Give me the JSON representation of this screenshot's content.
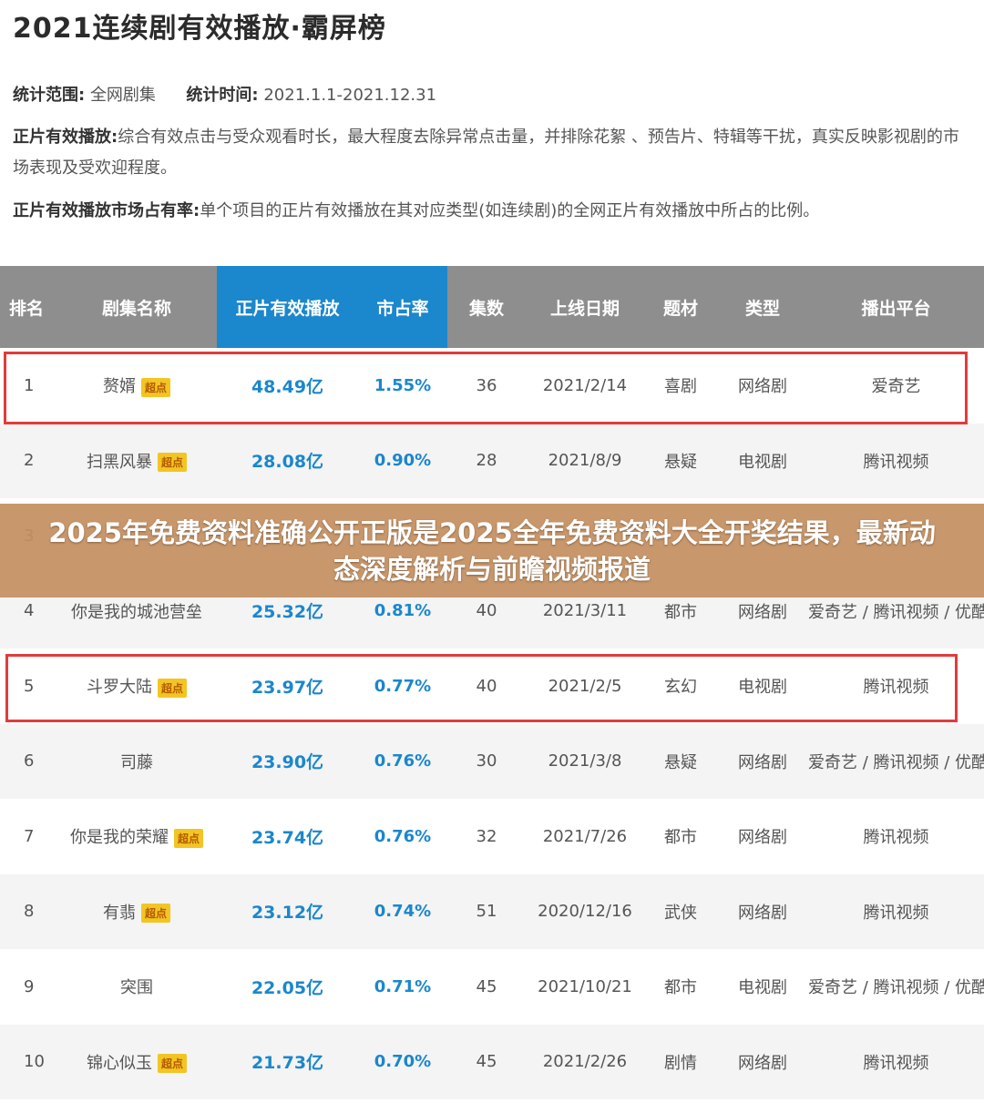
{
  "title": "2021连续剧有效播放·霸屏榜",
  "meta": {
    "scope_label": "统计范围:",
    "scope_value": "全网剧集",
    "time_label": "统计时间:",
    "time_value": "2021.1.1-2021.12.31",
    "play_label": "正片有效播放:",
    "play_desc": "综合有效点击与受众观看时长，最大程度去除异常点击量，并排除花絮 、预告片、特辑等干扰，真实反映影视剧的市场表现及受欢迎程度。",
    "share_label": "正片有效播放市场占有率:",
    "share_desc": "单个项目的正片有效播放在其对应类型(如连续剧)的全网正片有效播放中所占的比例。"
  },
  "table": {
    "headers": [
      "排名",
      "剧集名称",
      "正片有效播放",
      "市占率",
      "集数",
      "上线日期",
      "题材",
      "类型",
      "播出平台"
    ],
    "rows": [
      {
        "rank": "1",
        "name": "赘婿",
        "badge": "超点",
        "play": "48.49亿",
        "share": "1.55%",
        "eps": "36",
        "date": "2021/2/14",
        "genre": "喜剧",
        "type": "网络剧",
        "platform": "爱奇艺"
      },
      {
        "rank": "2",
        "name": "扫黑风暴",
        "badge": "超点",
        "play": "28.08亿",
        "share": "0.90%",
        "eps": "28",
        "date": "2021/8/9",
        "genre": "悬疑",
        "type": "电视剧",
        "platform": "腾讯视频"
      },
      {
        "rank": "3",
        "name": "",
        "badge": "",
        "play": "",
        "share": "",
        "eps": "",
        "date": "",
        "genre": "",
        "type": "",
        "platform": ""
      },
      {
        "rank": "4",
        "name": "你是我的城池营垒",
        "badge": "",
        "play": "25.32亿",
        "share": "0.81%",
        "eps": "40",
        "date": "2021/3/11",
        "genre": "都市",
        "type": "网络剧",
        "platform": "爱奇艺 / 腾讯视频 / 优酷"
      },
      {
        "rank": "5",
        "name": "斗罗大陆",
        "badge": "超点",
        "play": "23.97亿",
        "share": "0.77%",
        "eps": "40",
        "date": "2021/2/5",
        "genre": "玄幻",
        "type": "电视剧",
        "platform": "腾讯视频"
      },
      {
        "rank": "6",
        "name": "司藤",
        "badge": "",
        "play": "23.90亿",
        "share": "0.76%",
        "eps": "30",
        "date": "2021/3/8",
        "genre": "悬疑",
        "type": "网络剧",
        "platform": "爱奇艺 / 腾讯视频 / 优酷"
      },
      {
        "rank": "7",
        "name": "你是我的荣耀",
        "badge": "超点",
        "play": "23.74亿",
        "share": "0.76%",
        "eps": "32",
        "date": "2021/7/26",
        "genre": "都市",
        "type": "网络剧",
        "platform": "腾讯视频"
      },
      {
        "rank": "8",
        "name": "有翡",
        "badge": "超点",
        "play": "23.12亿",
        "share": "0.74%",
        "eps": "51",
        "date": "2020/12/16",
        "genre": "武侠",
        "type": "网络剧",
        "platform": "腾讯视频"
      },
      {
        "rank": "9",
        "name": "突围",
        "badge": "",
        "play": "22.05亿",
        "share": "0.71%",
        "eps": "45",
        "date": "2021/10/21",
        "genre": "都市",
        "type": "电视剧",
        "platform": "爱奇艺 / 腾讯视频 / 优酷"
      },
      {
        "rank": "10",
        "name": "锦心似玉",
        "badge": "超点",
        "play": "21.73亿",
        "share": "0.70%",
        "eps": "45",
        "date": "2021/2/26",
        "genre": "剧情",
        "type": "网络剧",
        "platform": "腾讯视频"
      }
    ]
  },
  "banner": {
    "text": "2025年免费资料准确公开正版是2025全年免费资料大全开奖结果，最新动态深度解析与前瞻视频报道"
  },
  "colors": {
    "accent": "#1b87cc",
    "header_bg": "#8e8e8e",
    "highlight": "#e23b3b",
    "badge": "#f2c523",
    "banner": "#c48f60"
  }
}
